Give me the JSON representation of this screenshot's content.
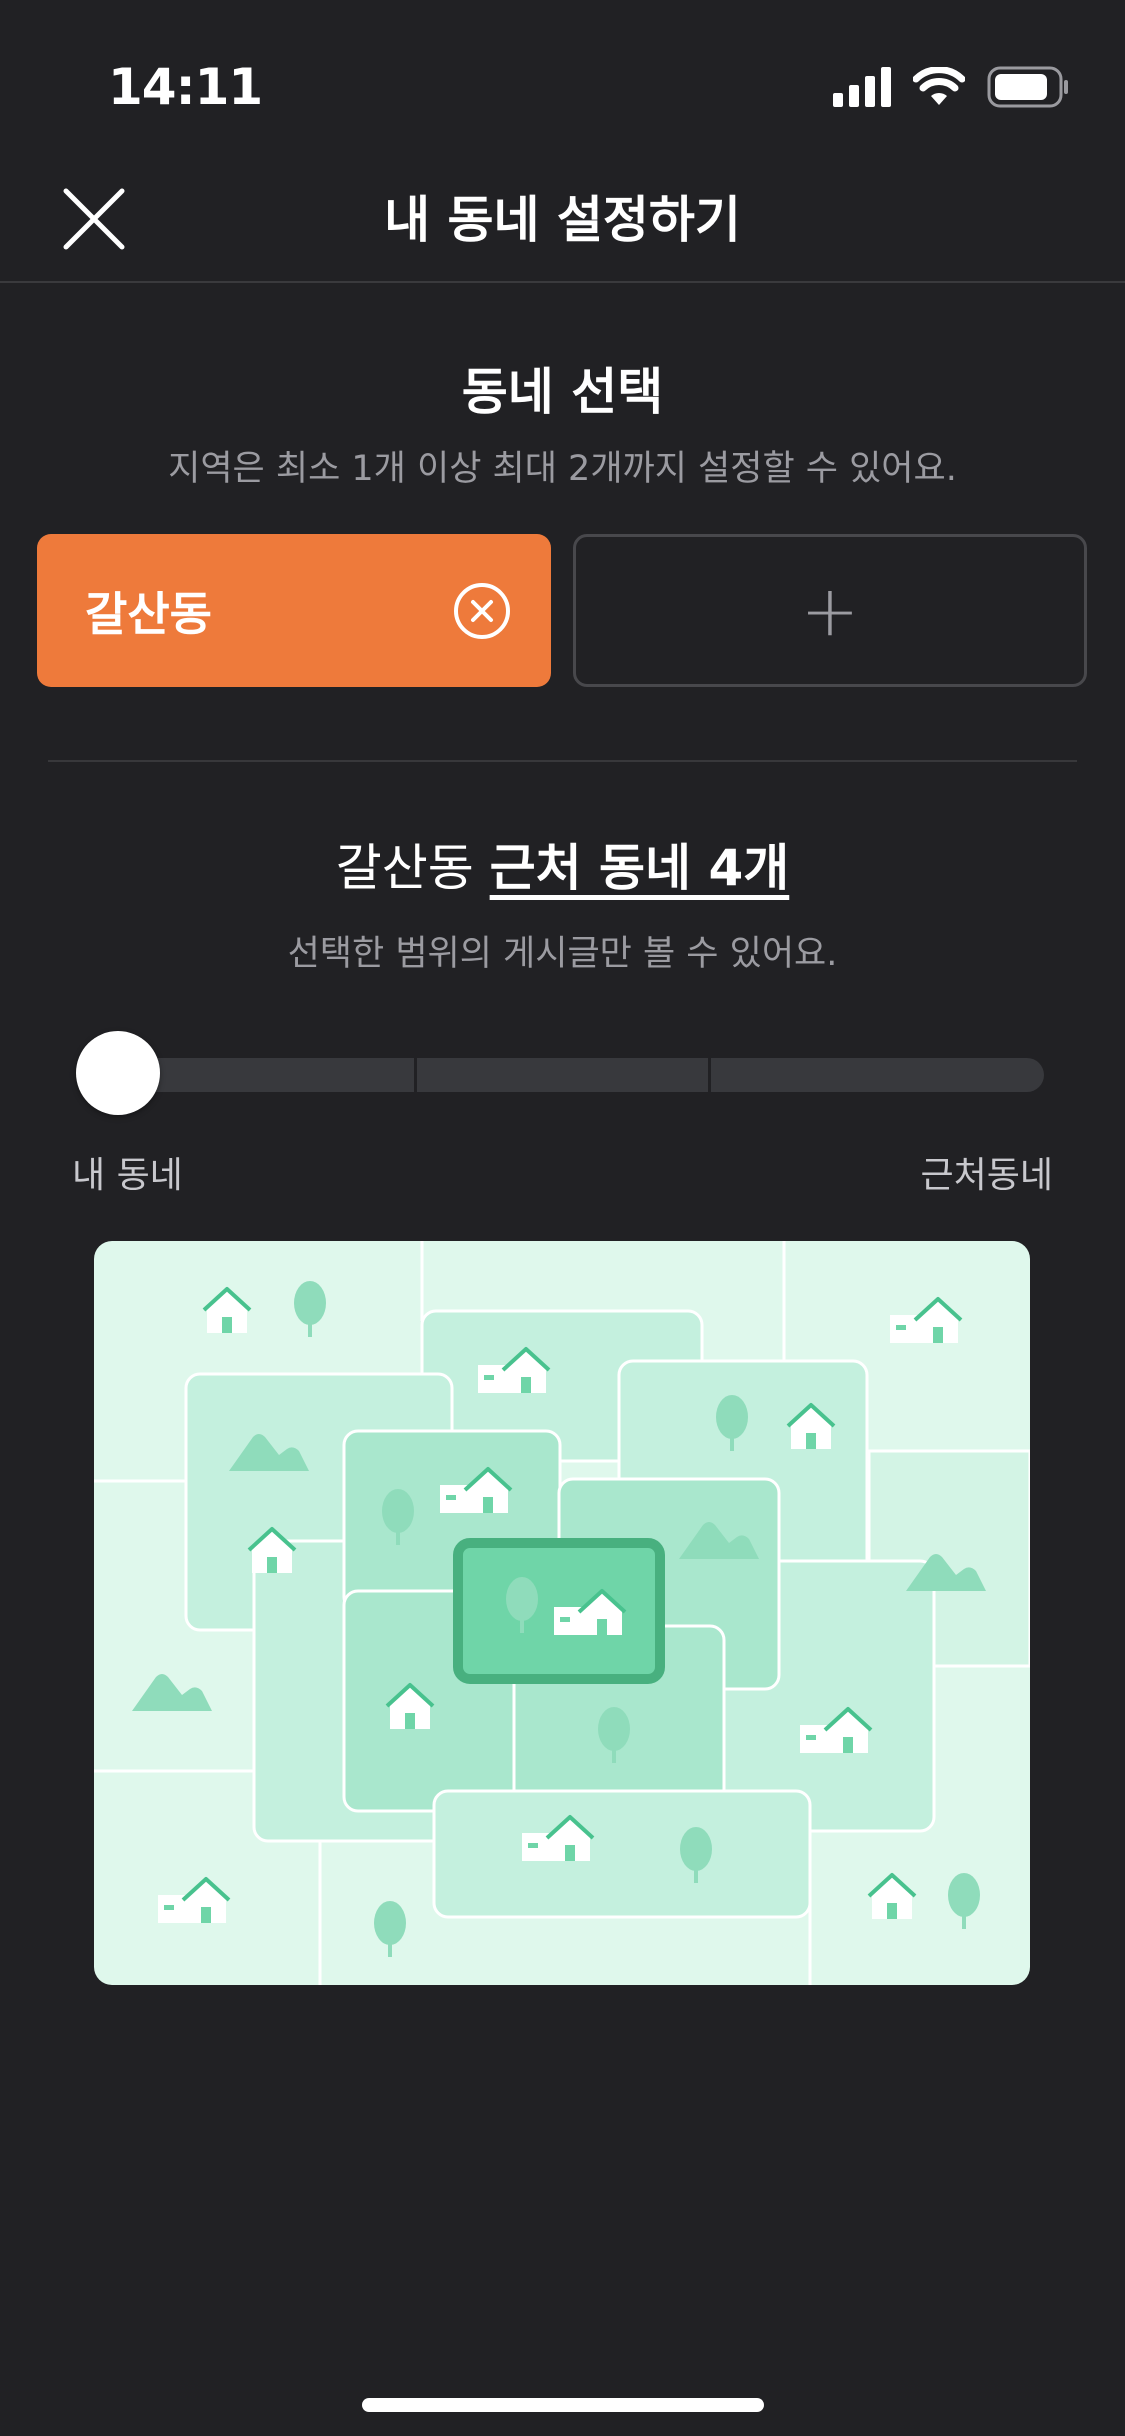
{
  "status_bar": {
    "time": "14:11"
  },
  "nav": {
    "title": "내 동네 설정하기"
  },
  "neighborhood_select": {
    "title": "동네 선택",
    "subtitle": "지역은 최소 1개 이상 최대 2개까지 설정할 수 있어요.",
    "selected_chip": "갈산동",
    "add_chip": "+"
  },
  "range": {
    "title_prefix": "갈산동 ",
    "title_highlight": "근처 동네 4개",
    "subtitle": "선택한 범위의 게시글만 볼 수 있어요.",
    "min_label": "내 동네",
    "max_label": "근처동네",
    "level": 0,
    "steps": 4
  },
  "colors": {
    "accent": "#ee7a3b",
    "background": "#212124",
    "map_light": "#dff8ec",
    "map_mid": "#c4f0de",
    "map_dark": "#a9e7cd",
    "map_center": "#6fd5a8"
  },
  "icons": {
    "close": "close-icon",
    "remove_chip": "circle-x-icon",
    "add": "plus-icon"
  }
}
